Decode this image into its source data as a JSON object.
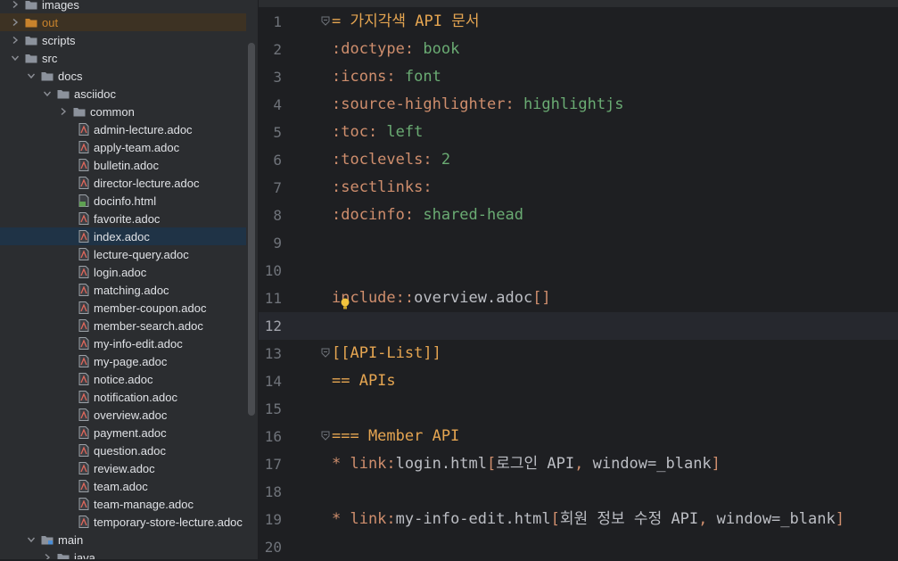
{
  "tree": [
    {
      "label": "images",
      "depth": 1,
      "type": "folder",
      "expanded": false
    },
    {
      "label": "out",
      "depth": 1,
      "type": "folder",
      "expanded": false,
      "excluded": true
    },
    {
      "label": "scripts",
      "depth": 1,
      "type": "folder",
      "expanded": false
    },
    {
      "label": "src",
      "depth": 1,
      "type": "folder",
      "expanded": true
    },
    {
      "label": "docs",
      "depth": 2,
      "type": "folder",
      "expanded": true
    },
    {
      "label": "asciidoc",
      "depth": 3,
      "type": "folder",
      "expanded": true
    },
    {
      "label": "common",
      "depth": 4,
      "type": "folder",
      "expanded": false
    },
    {
      "label": "admin-lecture.adoc",
      "depth": 4,
      "type": "adoc"
    },
    {
      "label": "apply-team.adoc",
      "depth": 4,
      "type": "adoc"
    },
    {
      "label": "bulletin.adoc",
      "depth": 4,
      "type": "adoc"
    },
    {
      "label": "director-lecture.adoc",
      "depth": 4,
      "type": "adoc"
    },
    {
      "label": "docinfo.html",
      "depth": 4,
      "type": "html"
    },
    {
      "label": "favorite.adoc",
      "depth": 4,
      "type": "adoc"
    },
    {
      "label": "index.adoc",
      "depth": 4,
      "type": "adoc",
      "selected": true
    },
    {
      "label": "lecture-query.adoc",
      "depth": 4,
      "type": "adoc"
    },
    {
      "label": "login.adoc",
      "depth": 4,
      "type": "adoc"
    },
    {
      "label": "matching.adoc",
      "depth": 4,
      "type": "adoc"
    },
    {
      "label": "member-coupon.adoc",
      "depth": 4,
      "type": "adoc"
    },
    {
      "label": "member-search.adoc",
      "depth": 4,
      "type": "adoc"
    },
    {
      "label": "my-info-edit.adoc",
      "depth": 4,
      "type": "adoc"
    },
    {
      "label": "my-page.adoc",
      "depth": 4,
      "type": "adoc"
    },
    {
      "label": "notice.adoc",
      "depth": 4,
      "type": "adoc"
    },
    {
      "label": "notification.adoc",
      "depth": 4,
      "type": "adoc"
    },
    {
      "label": "overview.adoc",
      "depth": 4,
      "type": "adoc"
    },
    {
      "label": "payment.adoc",
      "depth": 4,
      "type": "adoc"
    },
    {
      "label": "question.adoc",
      "depth": 4,
      "type": "adoc"
    },
    {
      "label": "review.adoc",
      "depth": 4,
      "type": "adoc"
    },
    {
      "label": "team.adoc",
      "depth": 4,
      "type": "adoc"
    },
    {
      "label": "team-manage.adoc",
      "depth": 4,
      "type": "adoc"
    },
    {
      "label": "temporary-store-lecture.adoc",
      "depth": 4,
      "type": "adoc"
    },
    {
      "label": "main",
      "depth": 2,
      "type": "module",
      "expanded": true
    },
    {
      "label": "java",
      "depth": 3,
      "type": "folder",
      "expanded": false
    }
  ],
  "editor": {
    "current_line": 12,
    "lines": [
      {
        "n": "1",
        "fold": true,
        "parts": [
          [
            "h",
            "= 가지각색 API 문서"
          ]
        ]
      },
      {
        "n": "2",
        "parts": [
          [
            "k",
            ":doctype:"
          ],
          [
            "v",
            " book"
          ]
        ]
      },
      {
        "n": "3",
        "parts": [
          [
            "k",
            ":icons:"
          ],
          [
            "v",
            " font"
          ]
        ]
      },
      {
        "n": "4",
        "parts": [
          [
            "k",
            ":source-highlighter:"
          ],
          [
            "v",
            " highlightjs"
          ]
        ]
      },
      {
        "n": "5",
        "parts": [
          [
            "k",
            ":toc:"
          ],
          [
            "v",
            " left"
          ]
        ]
      },
      {
        "n": "6",
        "parts": [
          [
            "k",
            ":toclevels:"
          ],
          [
            "v",
            " 2"
          ]
        ]
      },
      {
        "n": "7",
        "parts": [
          [
            "k",
            ":sectlinks:"
          ]
        ]
      },
      {
        "n": "8",
        "parts": [
          [
            "k",
            ":docinfo:"
          ],
          [
            "v",
            " shared-head"
          ]
        ]
      },
      {
        "n": "9",
        "parts": []
      },
      {
        "n": "10",
        "parts": []
      },
      {
        "n": "11",
        "bulb": true,
        "parts": [
          [
            "k",
            "include::"
          ],
          [
            "t",
            "overview.adoc"
          ],
          [
            "k",
            "[]"
          ]
        ]
      },
      {
        "n": "12",
        "parts": []
      },
      {
        "n": "13",
        "fold": true,
        "parts": [
          [
            "h",
            "[[API-List]]"
          ]
        ]
      },
      {
        "n": "14",
        "parts": [
          [
            "h",
            "== APIs"
          ]
        ]
      },
      {
        "n": "15",
        "parts": []
      },
      {
        "n": "16",
        "fold": true,
        "parts": [
          [
            "h",
            "=== Member API"
          ]
        ]
      },
      {
        "n": "17",
        "parts": [
          [
            "k",
            "* link:"
          ],
          [
            "t",
            "login.html"
          ],
          [
            "k",
            "["
          ],
          [
            "t",
            "로그인 API"
          ],
          [
            "k",
            ","
          ],
          [
            "t",
            " window=_blank"
          ],
          [
            "k",
            "]"
          ]
        ]
      },
      {
        "n": "18",
        "parts": []
      },
      {
        "n": "19",
        "parts": [
          [
            "k",
            "* link:"
          ],
          [
            "t",
            "my-info-edit.html"
          ],
          [
            "k",
            "["
          ],
          [
            "t",
            "회원 정보 수정 API"
          ],
          [
            "k",
            ","
          ],
          [
            "t",
            " window=_blank"
          ],
          [
            "k",
            "]"
          ]
        ]
      },
      {
        "n": "20",
        "parts": []
      }
    ]
  },
  "colors": {
    "keyword": "#cf8e6d",
    "value": "#6aab73",
    "heading": "#e5a551",
    "text": "#bcbec4"
  }
}
